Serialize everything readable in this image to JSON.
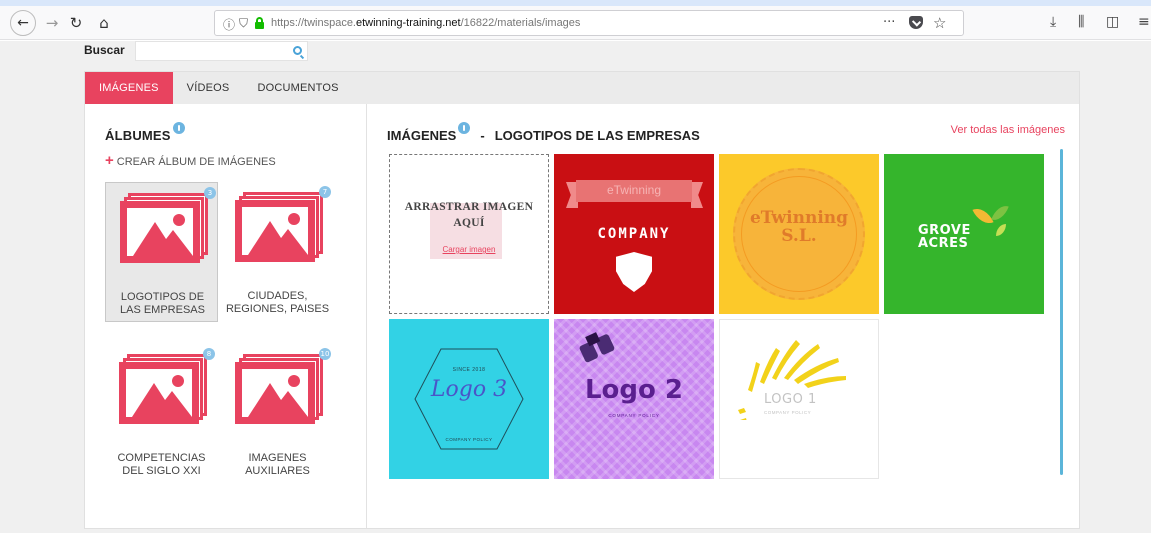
{
  "browser": {
    "url_prefix": "https://twinspace.",
    "url_domain": "etwinning-training.net",
    "url_path": "/16822/materials/images",
    "more_label": "···"
  },
  "search": {
    "label": "Buscar",
    "value": "",
    "placeholder": ""
  },
  "tabs": [
    {
      "label": "IMÁGENES",
      "active": true
    },
    {
      "label": "VÍDEOS",
      "active": false
    },
    {
      "label": "DOCUMENTOS",
      "active": false
    }
  ],
  "albums": {
    "title": "ÁLBUMES",
    "create_label": "CREAR ÁLBUM DE IMÁGENES",
    "items": [
      {
        "label_line1": "LOGOTIPOS DE",
        "label_line2": "LAS EMPRESAS",
        "count": "3",
        "selected": true
      },
      {
        "label_line1": "CIUDADES,",
        "label_line2": "REGIONES, PAISES",
        "count": "7",
        "selected": false
      },
      {
        "label_line1": "COMPETENCIAS",
        "label_line2": "DEL SIGLO XXI",
        "count": "8",
        "selected": false
      },
      {
        "label_line1": "IMAGENES",
        "label_line2": "AUXILIARES",
        "count": "10",
        "selected": false
      }
    ]
  },
  "images": {
    "title": "IMÁGENES",
    "separator": "-",
    "album_name": "LOGOTIPOS DE LAS EMPRESAS",
    "view_all": "Ver todas las imágenes",
    "dropzone": {
      "title_line1": "ARRASTRAR IMAGEN",
      "title_line2": "AQUÍ",
      "upload_link": "Cargar imagen"
    },
    "tiles": {
      "company": {
        "ribbon": "eTwinning",
        "name": "COMPANY"
      },
      "etwinning": {
        "line1": "eTwinning",
        "line2": "S.L."
      },
      "grove": {
        "line1": "GROVE",
        "line2": "ACRES"
      },
      "logo3": {
        "since": "SINCE 2018",
        "name": "Logo 3",
        "sub": "COMPANY POLICY"
      },
      "logo2": {
        "name": "Logo 2",
        "sub": "COMPANY POLICY"
      },
      "logo1": {
        "name": "LOGO 1",
        "sub": "COMPANY POLICY"
      }
    }
  }
}
